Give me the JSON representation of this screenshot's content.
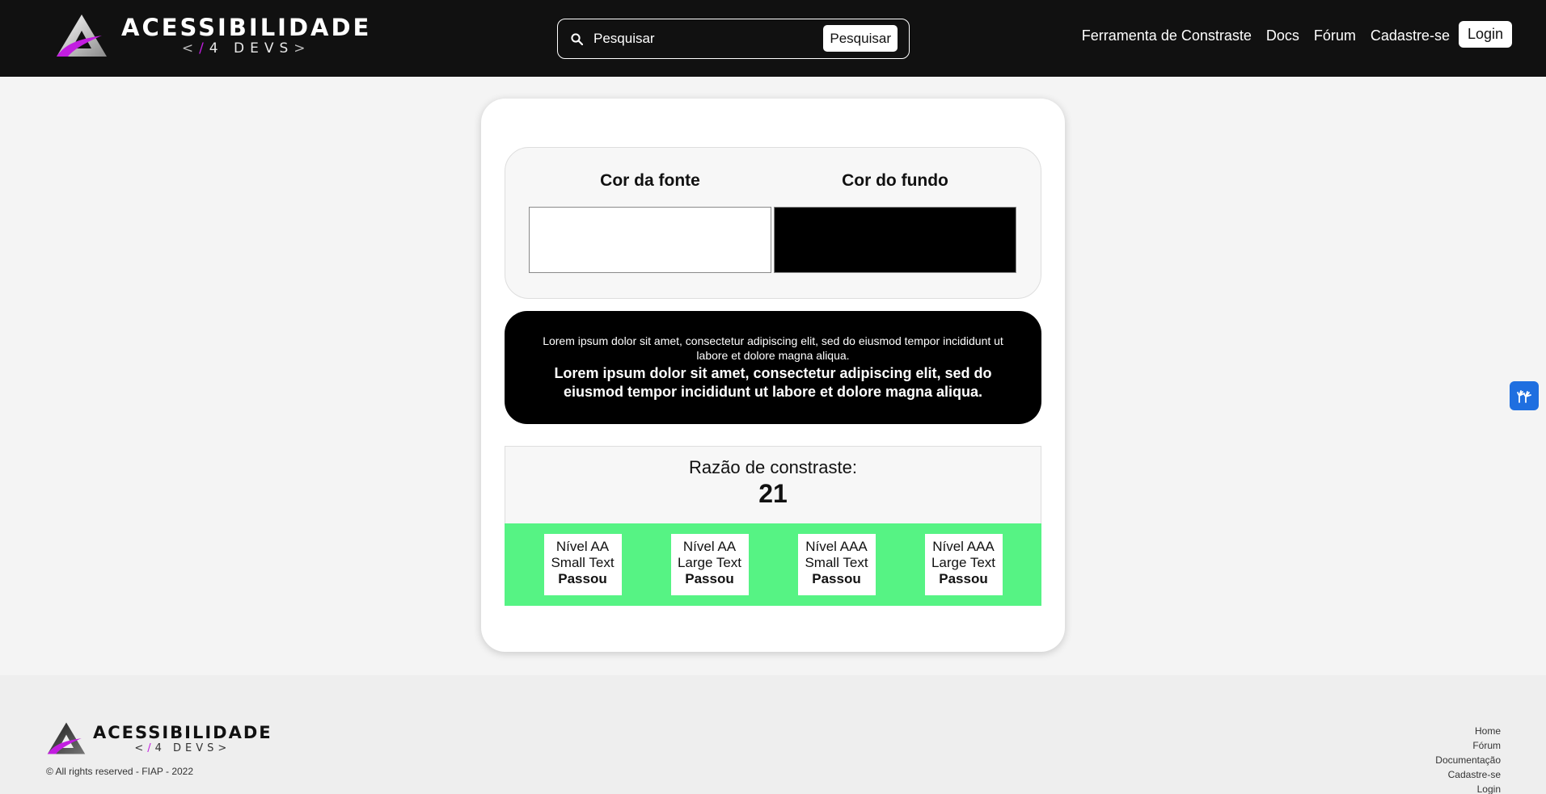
{
  "header": {
    "logo_title": "ACESSIBILIDADE",
    "logo_sub_open": "<",
    "logo_sub_slash": "/",
    "logo_sub_text": "4 DEVS",
    "logo_sub_close": ">",
    "search_placeholder": "Pesquisar",
    "search_button": "Pesquisar",
    "nav": {
      "contrast_tool": "Ferramenta de Constraste",
      "docs": "Docs",
      "forum": "Fórum",
      "signup": "Cadastre-se",
      "login": "Login"
    }
  },
  "colors": {
    "font_label": "Cor da fonte",
    "bg_label": "Cor do fundo",
    "font_color": "#ffffff",
    "bg_color": "#000000"
  },
  "preview": {
    "small_text": "Lorem ipsum dolor sit amet, consectetur adipiscing elit, sed do eiusmod tempor incididunt ut labore et dolore magna aliqua.",
    "large_text": "Lorem ipsum dolor sit amet, consectetur adipiscing elit, sed do eiusmod tempor incididunt ut labore et dolore magna aliqua."
  },
  "ratio": {
    "label": "Razão de constraste:",
    "value": "21"
  },
  "levels": [
    {
      "level": "Nível AA",
      "size": "Small Text",
      "result": "Passou"
    },
    {
      "level": "Nível AA",
      "size": "Large Text",
      "result": "Passou"
    },
    {
      "level": "Nível AAA",
      "size": "Small Text",
      "result": "Passou"
    },
    {
      "level": "Nível AAA",
      "size": "Large Text",
      "result": "Passou"
    }
  ],
  "levels_bg_color": "#56f384",
  "footer": {
    "logo_title": "ACESSIBILIDADE",
    "logo_sub_open": "<",
    "logo_sub_slash": "/",
    "logo_sub_text": "4 DEVS",
    "logo_sub_close": ">",
    "copyright": "© All rights reserved - FIAP - 2022",
    "links": {
      "home": "Home",
      "forum": "Fórum",
      "docs": "Documentação",
      "signup": "Cadastre-se",
      "login": "Login"
    }
  },
  "accent_color": "#c21de0",
  "widget_icon": "sign-language-hands-icon"
}
